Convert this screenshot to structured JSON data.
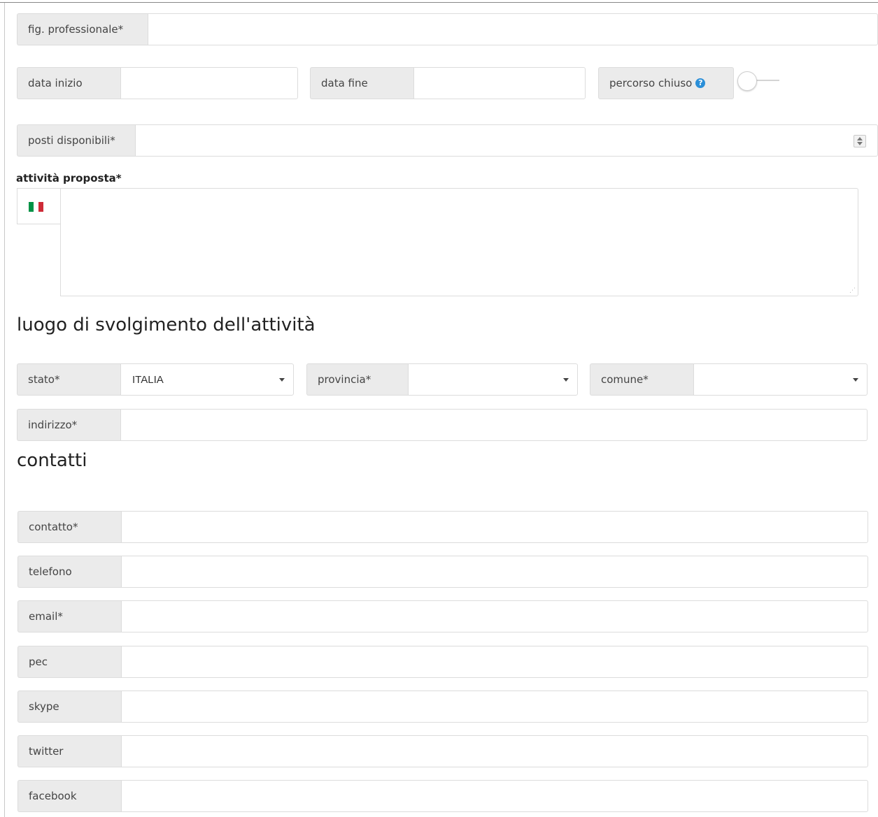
{
  "fig_professionale": {
    "label": "fig. professionale*",
    "value": ""
  },
  "dates": {
    "start": {
      "label": "data inizio",
      "value": ""
    },
    "end": {
      "label": "data fine",
      "value": ""
    },
    "closed": {
      "label": "percorso chiuso",
      "toggle_on": false
    }
  },
  "posti": {
    "label": "posti disponibili*",
    "value": ""
  },
  "attivita": {
    "label": "attività proposta*",
    "language_icon": "italian-flag-icon",
    "value": ""
  },
  "luogo": {
    "title": "luogo di svolgimento dell'attività",
    "stato": {
      "label": "stato*",
      "value": "ITALIA"
    },
    "provincia": {
      "label": "provincia*",
      "value": ""
    },
    "comune": {
      "label": "comune*",
      "value": ""
    },
    "indirizzo": {
      "label": "indirizzo*",
      "value": ""
    }
  },
  "contatti": {
    "title": "contatti",
    "fields": [
      {
        "label": "contatto*",
        "value": ""
      },
      {
        "label": "telefono",
        "value": ""
      },
      {
        "label": "email*",
        "value": ""
      },
      {
        "label": "pec",
        "value": ""
      },
      {
        "label": "skype",
        "value": ""
      },
      {
        "label": "twitter",
        "value": ""
      },
      {
        "label": "facebook",
        "value": ""
      }
    ]
  },
  "colors": {
    "addon_bg": "#ebebeb",
    "border": "#dcdcdc",
    "info_icon": "#2b8fd8"
  }
}
